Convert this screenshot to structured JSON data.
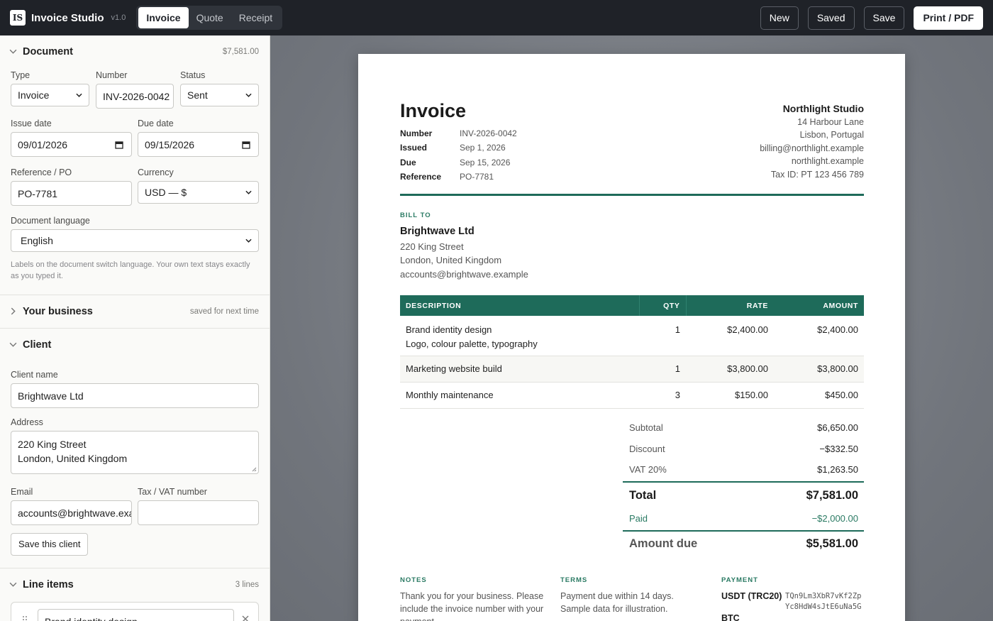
{
  "topbar": {
    "logo_text": "IS",
    "app_name": "Invoice Studio",
    "version": "v1.0",
    "modes": [
      "Invoice",
      "Quote",
      "Receipt"
    ],
    "active_mode": "Invoice",
    "actions": {
      "new": "New",
      "saved": "Saved",
      "save": "Save",
      "print": "Print / PDF"
    }
  },
  "sidebar": {
    "document": {
      "title": "Document",
      "total": "$7,581.00",
      "type_label": "Type",
      "type_value": "Invoice",
      "number_label": "Number",
      "number_value": "INV-2026-0042",
      "status_label": "Status",
      "status_value": "Sent",
      "issue_label": "Issue date",
      "issue_value": "09/01/2026",
      "due_label": "Due date",
      "due_value": "09/15/2026",
      "ref_label": "Reference / PO",
      "ref_value": "PO-7781",
      "currency_label": "Currency",
      "currency_value": "USD — $",
      "lang_label": "Document language",
      "lang_value": "English",
      "lang_hint": "Labels on the document switch language. Your own text stays exactly as you typed it."
    },
    "business": {
      "title": "Your business",
      "meta": "saved for next time"
    },
    "client": {
      "title": "Client",
      "name_label": "Client name",
      "name_value": "Brightwave Ltd",
      "address_label": "Address",
      "address_line1": "220 King Street",
      "address_line2": "London, United Kingdom",
      "email_label": "Email",
      "email_value": "accounts@brightwave.example",
      "tax_label": "Tax / VAT number",
      "tax_value": "",
      "save_button": "Save this client"
    },
    "line_items": {
      "title": "Line items",
      "meta": "3 lines",
      "first_item": "Brand identity design"
    }
  },
  "invoice": {
    "title": "Invoice",
    "meta": [
      {
        "k": "Number",
        "v": "INV-2026-0042"
      },
      {
        "k": "Issued",
        "v": "Sep 1, 2026"
      },
      {
        "k": "Due",
        "v": "Sep 15, 2026"
      },
      {
        "k": "Reference",
        "v": "PO-7781"
      }
    ],
    "from": {
      "name": "Northlight Studio",
      "lines": [
        "14 Harbour Lane",
        "Lisbon, Portugal",
        "billing@northlight.example",
        "northlight.example",
        "Tax ID: PT 123 456 789"
      ]
    },
    "bill_to_label": "BILL TO",
    "bill_to": {
      "name": "Brightwave Ltd",
      "lines": [
        "220 King Street",
        "London, United Kingdom",
        "accounts@brightwave.example"
      ]
    },
    "columns": [
      "DESCRIPTION",
      "QTY",
      "RATE",
      "AMOUNT"
    ],
    "items": [
      {
        "desc": "Brand identity design",
        "sub": "Logo, colour palette, typography",
        "qty": "1",
        "rate": "$2,400.00",
        "amount": "$2,400.00"
      },
      {
        "desc": "Marketing website build",
        "qty": "1",
        "rate": "$3,800.00",
        "amount": "$3,800.00"
      },
      {
        "desc": "Monthly maintenance",
        "qty": "3",
        "rate": "$150.00",
        "amount": "$450.00"
      }
    ],
    "totals": {
      "subtotal_k": "Subtotal",
      "subtotal_v": "$6,650.00",
      "discount_k": "Discount",
      "discount_v": "−$332.50",
      "vat_k": "VAT 20%",
      "vat_v": "$1,263.50",
      "total_k": "Total",
      "total_v": "$7,581.00",
      "paid_k": "Paid",
      "paid_v": "−$2,000.00",
      "due_k": "Amount due",
      "due_v": "$5,581.00"
    },
    "notes_label": "NOTES",
    "notes": "Thank you for your business. Please include the invoice number with your payment.",
    "terms_label": "TERMS",
    "terms": "Payment due within 14 days. Sample data for illustration.",
    "payment_label": "PAYMENT",
    "payment": {
      "method": "USDT (TRC20)",
      "address_1": "TQn9Lm3XbR7vKf2Zp",
      "address_2": "Yc8HdW4sJtE6uNa5G",
      "method2": "BTC"
    }
  },
  "colors": {
    "accent": "#1e6b5a",
    "topbar": "#1f2228",
    "canvas": "#71757c"
  }
}
